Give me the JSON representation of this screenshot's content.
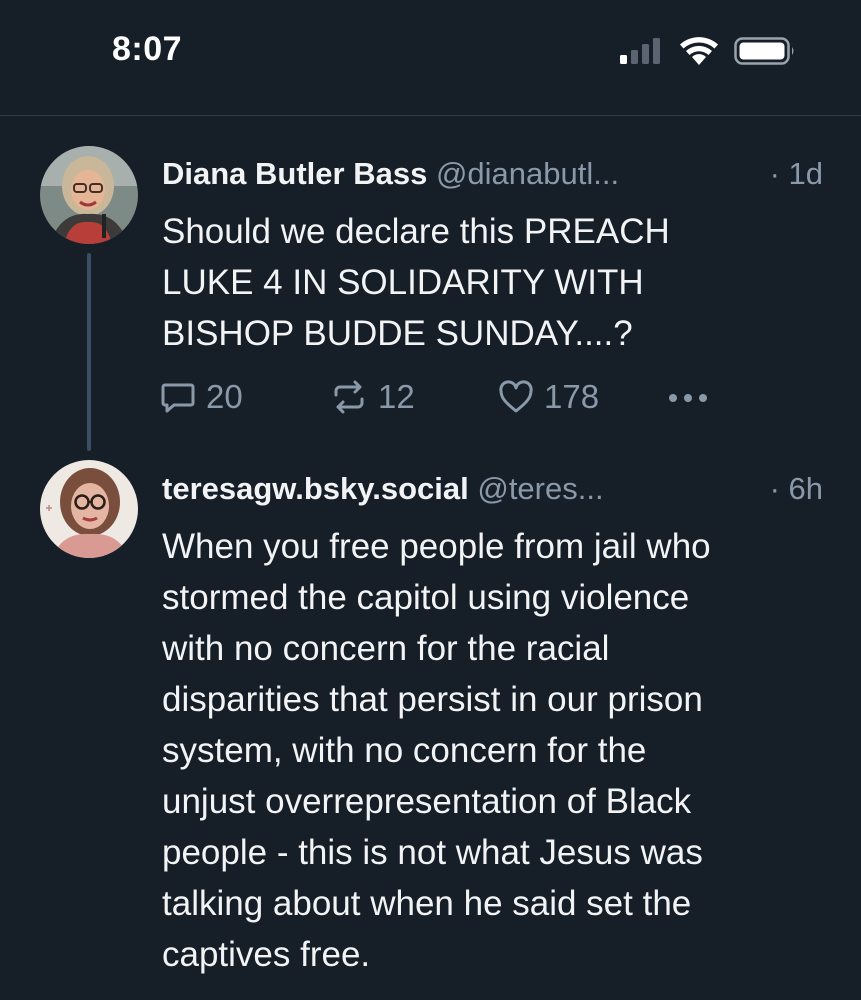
{
  "status_bar": {
    "time": "8:07",
    "icons": [
      "cellular-signal-icon",
      "wifi-icon",
      "battery-icon"
    ]
  },
  "colors": {
    "background": "#161e27",
    "text": "#f1f3f5",
    "muted": "#8a99a9",
    "thread_line": "#3b4d61",
    "divider": "#2e3a47"
  },
  "posts": [
    {
      "display_name": "Diana Butler Bass",
      "handle": "@dianabutl...",
      "time": "· 1d",
      "text": "Should we declare this PREACH\nLUKE 4 IN SOLIDARITY WITH\nBISHOP BUDDE SUNDAY....?",
      "reply_count": "20",
      "repost_count": "12",
      "like_count": "178",
      "icons": [
        "reply-icon",
        "repost-icon",
        "like-icon",
        "more-icon"
      ]
    },
    {
      "display_name": "teresagw.bsky.social",
      "handle": "@teres...",
      "time": "· 6h",
      "text": "When you free people from jail who\nstormed the capitol using violence\nwith no concern for the racial\ndisparities that persist in our prison\nsystem, with no concern for the\nunjust overrepresentation of Black\npeople - this is not what Jesus was\ntalking about when he said set the\ncaptives free."
    }
  ]
}
